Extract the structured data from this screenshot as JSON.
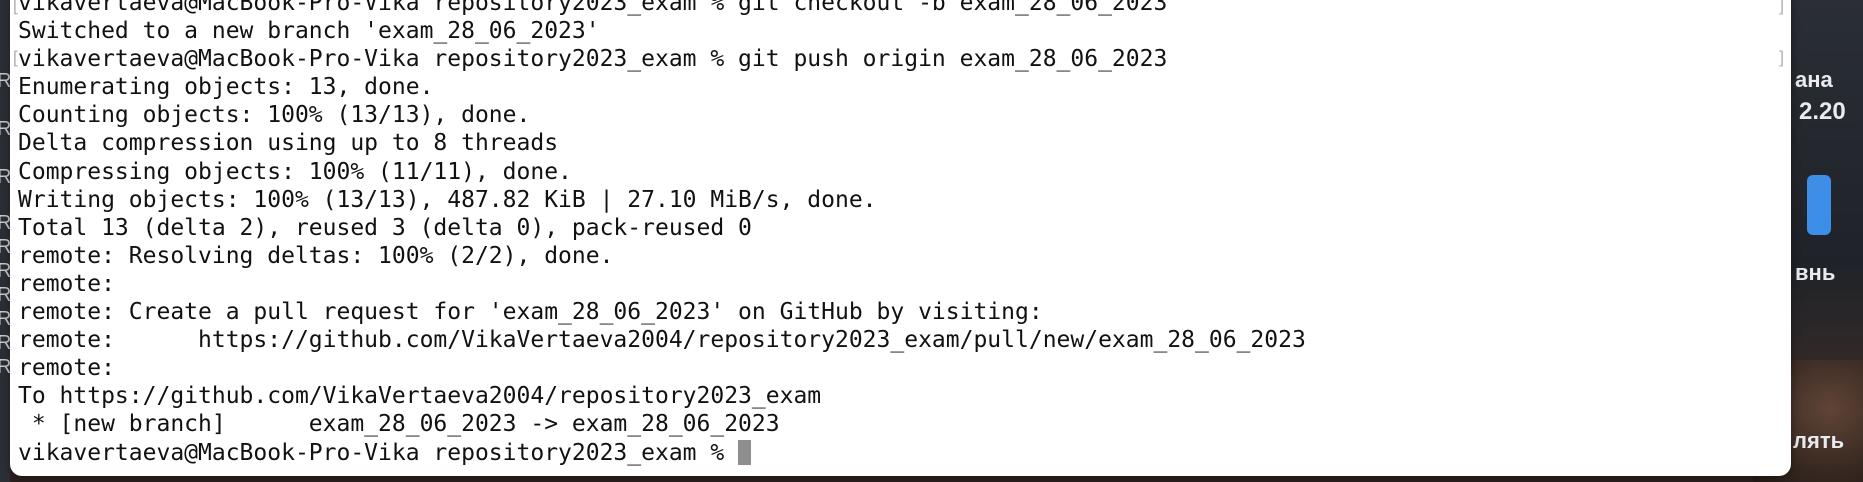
{
  "terminal": {
    "lines": [
      "vikavertaeva@MacBook-Pro-Vika repository2023_exam % git checkout -b exam_28_06_2023",
      "Switched to a new branch 'exam_28_06_2023'",
      "vikavertaeva@MacBook-Pro-Vika repository2023_exam % git push origin exam_28_06_2023",
      "Enumerating objects: 13, done.",
      "Counting objects: 100% (13/13), done.",
      "Delta compression using up to 8 threads",
      "Compressing objects: 100% (11/11), done.",
      "Writing objects: 100% (13/13), 487.82 KiB | 27.10 MiB/s, done.",
      "Total 13 (delta 2), reused 3 (delta 0), pack-reused 0",
      "remote: Resolving deltas: 100% (2/2), done.",
      "remote:",
      "remote: Create a pull request for 'exam_28_06_2023' on GitHub by visiting:",
      "remote:      https://github.com/VikaVertaeva2004/repository2023_exam/pull/new/exam_28_06_2023",
      "remote:",
      "To https://github.com/VikaVertaeva2004/repository2023_exam",
      " * [new branch]      exam_28_06_2023 -> exam_28_06_2023"
    ],
    "prompt": "vikavertaeva@MacBook-Pro-Vika repository2023_exam % "
  },
  "widget": {
    "text1": "ана",
    "text2": "2.20",
    "text3": "внь",
    "text4": "лять"
  },
  "left_fragments": [
    "R",
    "R",
    "R",
    "R",
    "R",
    "R",
    "R",
    "R",
    "R",
    "R"
  ],
  "colors": {
    "terminal_bg": "#ffffff",
    "text": "#111111",
    "cursor": "#8e8e8e",
    "accent_button": "#3d8ee6"
  }
}
